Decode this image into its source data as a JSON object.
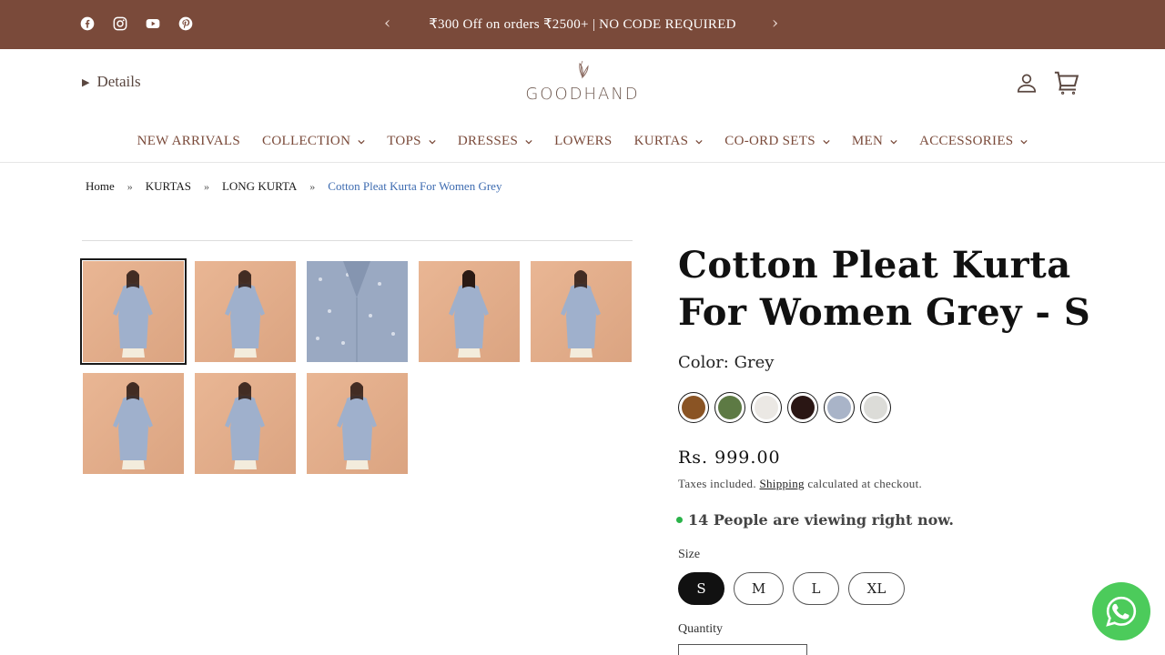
{
  "announcement": {
    "text": "₹300 Off on orders ₹2500+ | NO CODE REQUIRED",
    "prev_icon": "chevron-left-icon",
    "next_icon": "chevron-right-icon"
  },
  "social": [
    "facebook-icon",
    "instagram-icon",
    "youtube-icon",
    "pinterest-icon"
  ],
  "header": {
    "details_label": "Details",
    "logo_text": "GOODHAND",
    "icons": [
      "account-icon",
      "cart-icon"
    ]
  },
  "nav": [
    {
      "label": "NEW ARRIVALS",
      "dropdown": false
    },
    {
      "label": "COLLECTION",
      "dropdown": true
    },
    {
      "label": "TOPS",
      "dropdown": true
    },
    {
      "label": "DRESSES",
      "dropdown": true
    },
    {
      "label": "LOWERS",
      "dropdown": false
    },
    {
      "label": "KURTAS",
      "dropdown": true
    },
    {
      "label": "CO-ORD SETS",
      "dropdown": true
    },
    {
      "label": "MEN",
      "dropdown": true
    },
    {
      "label": "ACCESSORIES",
      "dropdown": true
    }
  ],
  "breadcrumb": {
    "items": [
      "Home",
      "KURTAS",
      "LONG KURTA"
    ],
    "separator": "»",
    "current": "Cotton Pleat Kurta For Women Grey"
  },
  "product": {
    "title": "Cotton Pleat Kurta For Women Grey - S",
    "color_label": "Color: Grey",
    "swatches": [
      "#8a5424",
      "#5d7a44",
      "#ebe8e4",
      "#2a1614",
      "#a9b4c8",
      "#dcdcd8"
    ],
    "price": "Rs. 999.00",
    "tax_prefix": "Taxes included.",
    "tax_link": "Shipping",
    "tax_suffix": "calculated at checkout.",
    "viewing_text": "14 People are viewing right now.",
    "size_label": "Size",
    "sizes": [
      "S",
      "M",
      "L",
      "XL"
    ],
    "selected_size": "S",
    "quantity_label": "Quantity"
  },
  "colors": {
    "topbar_bg": "#7a4a3a",
    "accent_text": "#7a4a3a",
    "breadcrumb_current": "#3d6bb0",
    "whatsapp": "#4ccb5b",
    "online_dot": "#2bb34a"
  },
  "whatsapp_icon": "whatsapp-icon"
}
